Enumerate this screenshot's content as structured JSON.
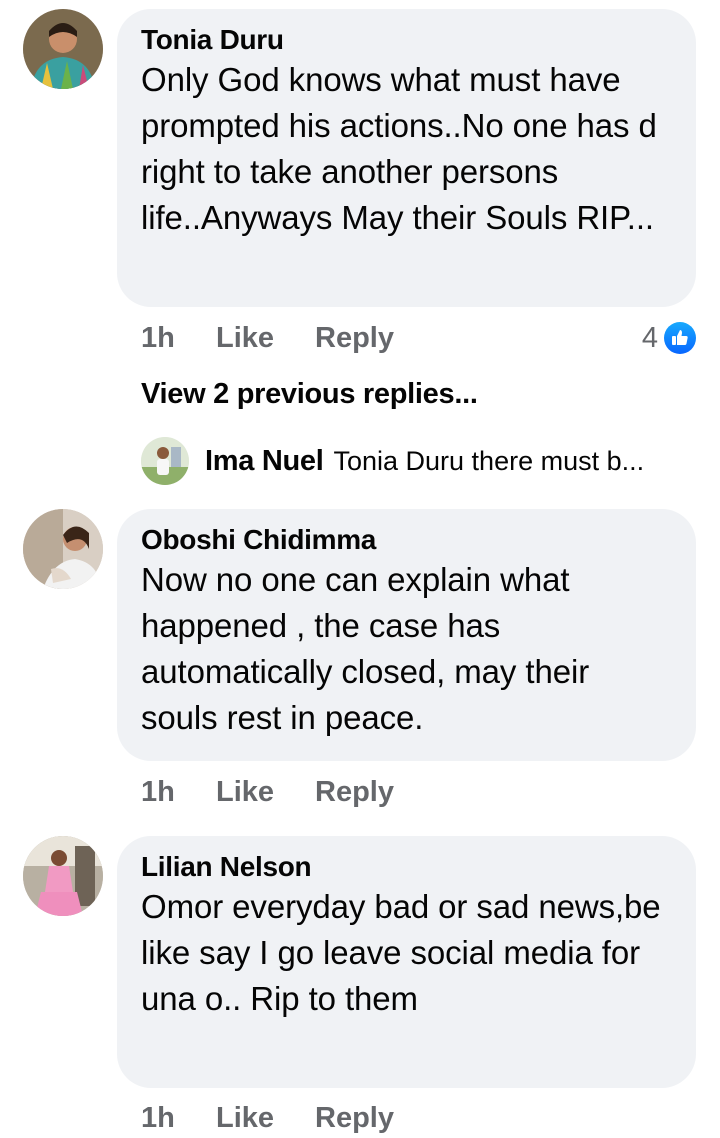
{
  "comments": [
    {
      "author": "Tonia Duru",
      "text": "Only God knows what must have prompted his actions..No one has d right to take another persons life..Anyways May their Souls RIP...",
      "time": "1h",
      "like_label": "Like",
      "reply_label": "Reply",
      "reaction_count": "4",
      "reaction_icon": "thumbs-up-icon"
    },
    {
      "author": "Oboshi Chidimma",
      "text": "Now no one can explain what happened , the case has automatically closed,  may their souls rest in peace.",
      "time": "1h",
      "like_label": "Like",
      "reply_label": "Reply"
    },
    {
      "author": "Lilian Nelson",
      "text": "Omor everyday bad or sad news,be like say I go leave social media for una o.. Rip to them",
      "time": "1h",
      "like_label": "Like",
      "reply_label": "Reply"
    }
  ],
  "replies": {
    "view_previous_label": "View 2 previous replies...",
    "latest": {
      "author": "Ima Nuel",
      "preview": "Tonia Duru there must b..."
    }
  },
  "colors": {
    "bubble": "#f0f2f5",
    "secondary_text": "#65676b",
    "like_blue": "#0866ff"
  }
}
